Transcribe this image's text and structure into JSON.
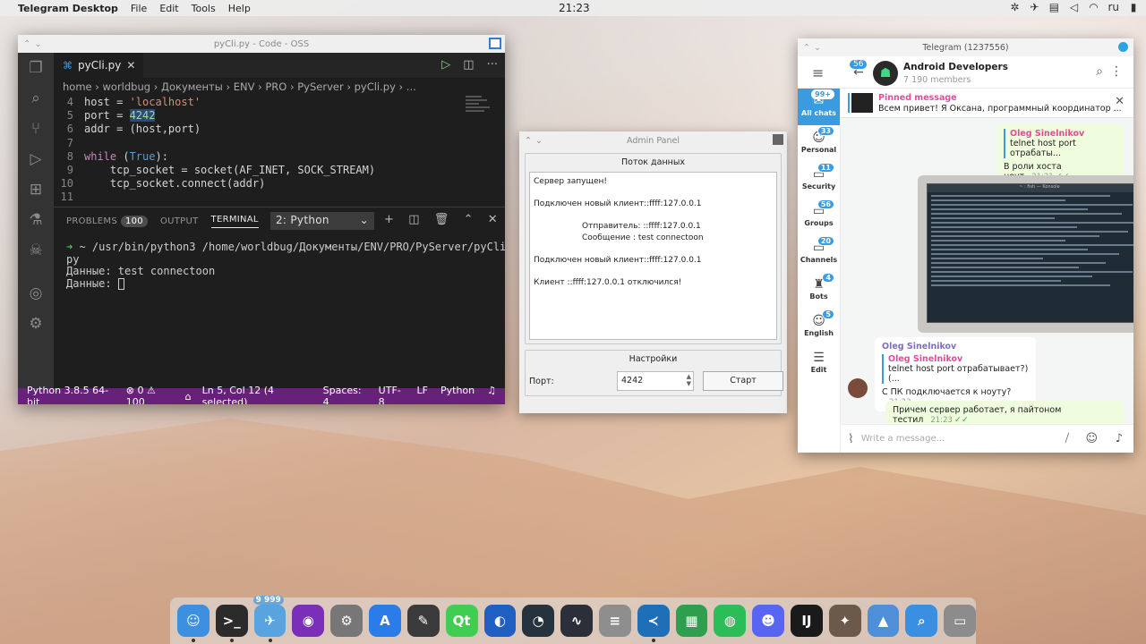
{
  "topbar": {
    "app_name": "Telegram Desktop",
    "menus": [
      "File",
      "Edit",
      "Tools",
      "Help"
    ],
    "clock": "21:23",
    "lang": "ru"
  },
  "vscode": {
    "title": "pyCli.py - Code - OSS",
    "tab_label": "pyCli.py",
    "breadcrumb": "home › worldbug › Документы › ENV › PRO › PyServer › pyCli.py › ...",
    "code_lines": [
      {
        "n": "4",
        "text": "host = 'localhost'"
      },
      {
        "n": "5",
        "text": "port = 4242"
      },
      {
        "n": "6",
        "text": "addr = (host,port)"
      },
      {
        "n": "7",
        "text": ""
      },
      {
        "n": "8",
        "text": "while (True):"
      },
      {
        "n": "9",
        "text": "    tcp_socket = socket(AF_INET, SOCK_STREAM)"
      },
      {
        "n": "10",
        "text": "    tcp_socket.connect(addr)"
      },
      {
        "n": "11",
        "text": ""
      }
    ],
    "panel": {
      "problems": "PROBLEMS",
      "problems_count": "100",
      "output": "OUTPUT",
      "terminal": "TERMINAL",
      "more": "···",
      "terminal_select": "2: Python"
    },
    "terminal_lines": {
      "cmd": "~ /usr/bin/python3 /home/worldbug/Документы/ENV/PRO/PyServer/pyCli.",
      "cmd_wrap": "py",
      "out1": "Данные: test connectoon",
      "out2": "Данные: "
    },
    "status": {
      "python": "Python 3.8.5 64-bit",
      "errors": "⊗ 0 ⚠ 100",
      "position": "Ln 5, Col 12 (4 selected)",
      "spaces": "Spaces: 4",
      "encoding": "UTF-8",
      "eol": "LF",
      "language": "Python"
    }
  },
  "admin": {
    "title": "Admin Panel",
    "stream_title": "Поток данных",
    "log": [
      "Сервер запущен!",
      "",
      "Подключен новый клиент::ffff:127.0.0.1",
      "",
      "Отправитель: ::ffff:127.0.0.1",
      "Сообщение  : test connectoon",
      "",
      "Подключен новый клиент::ffff:127.0.0.1",
      "",
      "Клиент ::ffff:127.0.0.1 отключился!"
    ],
    "settings_title": "Настройки",
    "port_label": "Порт:",
    "port_value": "4242",
    "start_label": "Старт"
  },
  "telegram": {
    "title": "Telegram (1237556)",
    "back_count": "56",
    "channel_name": "Android Developers",
    "members": "7 190 members",
    "folders": [
      {
        "label": "All chats",
        "badge": "99+",
        "icon": "chat-bubbles-icon"
      },
      {
        "label": "Personal",
        "badge": "33",
        "icon": "person-icon"
      },
      {
        "label": "Security",
        "badge": "11",
        "icon": "folder-icon"
      },
      {
        "label": "Groups",
        "badge": "56",
        "icon": "folder-icon"
      },
      {
        "label": "Channels",
        "badge": "20",
        "icon": "folder-icon"
      },
      {
        "label": "Bots",
        "badge": "4",
        "icon": "bot-icon"
      },
      {
        "label": "English",
        "badge": "5",
        "icon": "person-icon"
      },
      {
        "label": "Edit",
        "badge": "",
        "icon": "sliders-icon"
      }
    ],
    "pinned": {
      "title": "Pinned message",
      "text": "Всем привет! Я Оксана, программный координатор ..."
    },
    "msg1": {
      "quote_name": "Oleg Sinelnikov",
      "quote_text": "telnet host port отрабаты...",
      "text": "В роли хоста ноут",
      "time": "21:21"
    },
    "msg2": {
      "sender": "Oleg Sinelnikov",
      "quote_name": "Oleg Sinelnikov",
      "quote_text": "telnet host port отрабатывает?)(...",
      "text": "С ПК подключается к ноуту?",
      "time": "21:23"
    },
    "msg3": {
      "text": "Причем сервер работает, я пайтоном тестил",
      "time": "21:23"
    },
    "compose_placeholder": "Write a message..."
  },
  "dock": {
    "items": [
      {
        "name": "finder-icon",
        "color": "#3d8fe0",
        "glyph": "☺"
      },
      {
        "name": "terminal-icon",
        "color": "#2b2b2b",
        "glyph": ">_"
      },
      {
        "name": "telegram-icon",
        "color": "#58a3e0",
        "glyph": "✈",
        "badge": "9 999"
      },
      {
        "name": "podcast-icon",
        "color": "#7b2fb8",
        "glyph": "◉"
      },
      {
        "name": "settings-icon",
        "color": "#777777",
        "glyph": "⚙"
      },
      {
        "name": "app-store-icon",
        "color": "#2b7ce8",
        "glyph": "A"
      },
      {
        "name": "inkscape-icon",
        "color": "#3b3b3b",
        "glyph": "✎"
      },
      {
        "name": "qt-icon",
        "color": "#41cd52",
        "glyph": "Qt"
      },
      {
        "name": "firefox-icon",
        "color": "#1f5fc2",
        "glyph": "◐"
      },
      {
        "name": "speedometer-icon",
        "color": "#26323d",
        "glyph": "◔"
      },
      {
        "name": "pulse-icon",
        "color": "#2a2f3a",
        "glyph": "∿"
      },
      {
        "name": "database-icon",
        "color": "#8e8e8e",
        "glyph": "≡"
      },
      {
        "name": "vscode-icon",
        "color": "#1e6fb8",
        "glyph": "≺"
      },
      {
        "name": "spreadsheet-icon",
        "color": "#2f9e4f",
        "glyph": "▦"
      },
      {
        "name": "spotify-icon",
        "color": "#2bbd57",
        "glyph": "◍"
      },
      {
        "name": "discord-icon",
        "color": "#5865f2",
        "glyph": "☻"
      },
      {
        "name": "intellij-icon",
        "color": "#1a1a1a",
        "glyph": "IJ"
      },
      {
        "name": "gimp-icon",
        "color": "#6b5a4a",
        "glyph": "✦"
      },
      {
        "name": "installer-icon",
        "color": "#4f8fd8",
        "glyph": "▲"
      },
      {
        "name": "search-icon",
        "color": "#3b8fe0",
        "glyph": "⌕"
      },
      {
        "name": "disk-utility-icon",
        "color": "#8c8c8c",
        "glyph": "▭"
      }
    ]
  }
}
